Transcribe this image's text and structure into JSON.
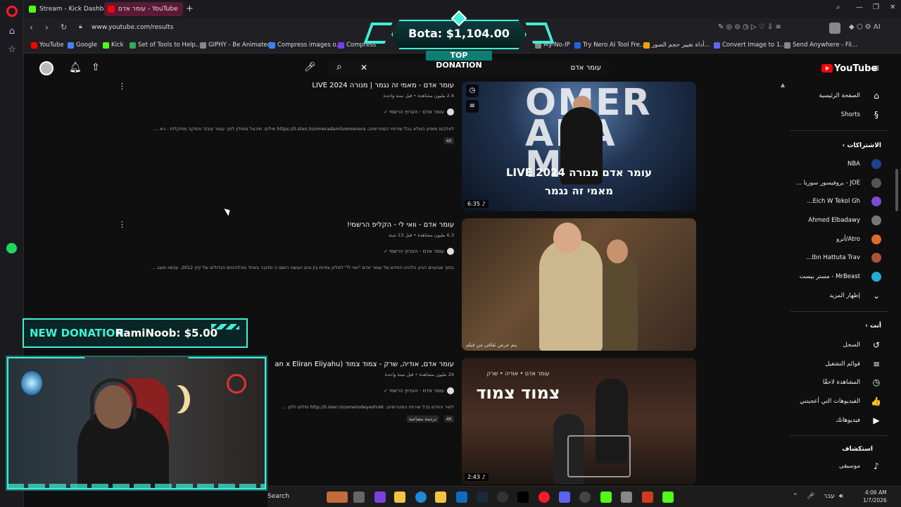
{
  "browser": {
    "tabs": [
      {
        "label": "Stream - Kick Dashboard",
        "color": "#53fc18"
      },
      {
        "label": "עומר אדם - YouTube",
        "color": "#ff0000"
      }
    ],
    "url": "www.youtube.com/results",
    "bookmarks": [
      {
        "label": "YouTube",
        "color": "#ff0000"
      },
      {
        "label": "Google",
        "color": "#4285f4"
      },
      {
        "label": "Kick",
        "color": "#53fc18"
      },
      {
        "label": "Set of Tools to Help...",
        "color": "#34a853"
      },
      {
        "label": "GIPHY - Be Animated",
        "color": "#888888"
      },
      {
        "label": "Compress images o...",
        "color": "#3b82f6"
      },
      {
        "label": "Compress",
        "color": "#7c3aed"
      },
      {
        "label": "My-No-IP",
        "color": "#888888"
      },
      {
        "label": "Try Nero AI Tool Fre...",
        "color": "#2563eb"
      },
      {
        "label": "أداة تغيير حجم الصور...",
        "color": "#f59e0b"
      },
      {
        "label": "Convert Image to 1...",
        "color": "#6366f1"
      },
      {
        "label": "Send Anywhere - Fil...",
        "color": "#888888"
      }
    ]
  },
  "youtube": {
    "search_query": "עומר אדם",
    "logo": "YouTube",
    "guide": {
      "top": [
        {
          "label": "الصفحة الرئيسية",
          "icon": "home-icon",
          "glyph": "⌂"
        },
        {
          "label": "Shorts",
          "icon": "shorts-icon",
          "glyph": "§"
        }
      ],
      "subscriptions_header": "الاشتراكات",
      "subscriptions": [
        {
          "label": "NBA",
          "color": "#1d428a"
        },
        {
          "label": "JOE - بروفيسور سوريا ...",
          "color": "#555555"
        },
        {
          "label": "Eich W Tekol Gh...",
          "color": "#7a4bd6"
        },
        {
          "label": "Ahmed Elbadawy",
          "color": "#777777"
        },
        {
          "label": "Atro/أترو",
          "color": "#e06a2a"
        },
        {
          "label": "Ibn Hattuta Trav...",
          "color": "#aa5533"
        },
        {
          "label": "MrBeast - مستر بيست",
          "color": "#2aa8d6"
        }
      ],
      "show_more": "إظهار المزيد",
      "you_header": "أنت",
      "you": [
        {
          "label": "السجل",
          "icon": "history-icon",
          "glyph": "↺"
        },
        {
          "label": "قوائم التشغيل",
          "icon": "playlists-icon",
          "glyph": "≡"
        },
        {
          "label": "المشاهدة لاحقًا",
          "icon": "watch-later-icon",
          "glyph": "◷"
        },
        {
          "label": "الفيديوهات التي أعجبتني",
          "icon": "like-icon",
          "glyph": "👍"
        },
        {
          "label": "فيديوهاتك",
          "icon": "your-videos-icon",
          "glyph": "▶"
        }
      ],
      "explore_header": "استكشاف",
      "explore": [
        {
          "label": "موسيقى",
          "icon": "music-icon",
          "glyph": "♪"
        }
      ]
    },
    "results": [
      {
        "title": "עומר אדם - מאמי זה נגמר | מנורה LIVE 2024",
        "meta": "2.4 مليون مشاهدة • قبل سنة واحدة",
        "channel": "עומר אדם - הערוץ הרשמי",
        "desc": "לאלבום מופיע המלא בכל שירותי הסטרימינג: https://li.sten.to/omeradamlivemenora מילים: מיכאל סמולין לחן: עומר עיבוד והפקה מוזיקלית - גיא ...",
        "badge": "4K",
        "duration": "6:35",
        "thumb_big": "OMER ADAM",
        "thumb_line1": "LIVE 2024 עומר אדם מנורה",
        "thumb_line2": "מאמי זה נגמר"
      },
      {
        "title": "עומר אדם - וואי לי - הקליפ הרשמי!",
        "meta": "6.3 مليون مشاهدة • قبل 13 سنة",
        "channel": "עומר אדם - הערוץ הרשמי",
        "desc": "בתוך שבועיים הגיע הלהיט החדש של עומר אדם \"וואי לי\" למליון צפיות בין טיוב ועושה רושם כי מדובר באחד מהלהיטים הגדולים של קיץ 2012. עכשיו מוצג ...",
        "caption": "يتم عرض ثقافي من فيلم"
      },
      {
        "title": "עומר אדם, אודיה, שרק - צמוד צמוד (an x Eliran Eliyahu",
        "meta": "29 مليون مشاهدة • قبل سنة واحدة",
        "channel": "עומר אדם - הערוץ הרשמי",
        "desc": "לשיר החדש בכל שירותי הסטרימינג: http://li.sten.to/omerodeyashrek מילים ולחן ...",
        "badge": "4K",
        "badge2": "ترجمة مصاحبة",
        "duration": "2:43",
        "thumb_small": "עומר אדם • אודיה • שרק",
        "thumb_title": "צמוד צמוד"
      }
    ]
  },
  "overlays": {
    "top_donation_amount": "Bota: $1,104.00",
    "top_donation_label": "TOP DONATION",
    "new_donation_title": "NEW DONATION",
    "new_donation_text": "RamiNoob: $5.00"
  },
  "taskbar": {
    "search_label": "Search",
    "lang": "עבר",
    "time": "4:06 AM",
    "date": "1/7/2026"
  }
}
